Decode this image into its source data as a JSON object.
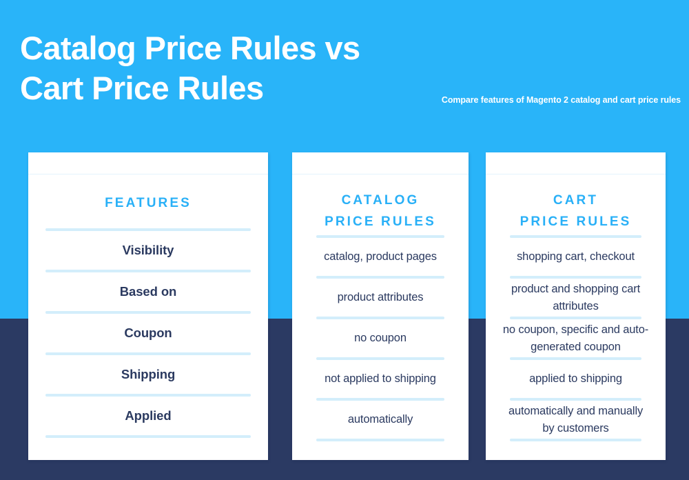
{
  "header": {
    "title": "Catalog Price Rules vs\nCart Price Rules",
    "subtitle": "Compare features of Magento 2 catalog and cart price rules"
  },
  "colors": {
    "background_top": "#29b4f9",
    "background_bottom": "#2b3a63",
    "accent_blue": "#29b0f7",
    "text_navy": "#2b3a60",
    "divider": "#d3eefb",
    "card_background": "#ffffff"
  },
  "comparison": {
    "columns": [
      {
        "id": "features",
        "heading": "FEATURES",
        "cells": [
          "Visibility",
          "Based on",
          "Coupon",
          "Shipping",
          "Applied"
        ]
      },
      {
        "id": "catalog-price-rules",
        "heading": "CATALOG\nPRICE RULES",
        "cells": [
          "catalog, product pages",
          "product attributes",
          "no coupon",
          "not applied to shipping",
          "automatically"
        ]
      },
      {
        "id": "cart-price-rules",
        "heading": "CART\nPRICE RULES",
        "cells": [
          "shopping cart, checkout",
          "product and shopping cart attributes",
          "no coupon, specific and auto-generated coupon",
          "applied to shipping",
          "automatically and manually by customers"
        ]
      }
    ]
  }
}
